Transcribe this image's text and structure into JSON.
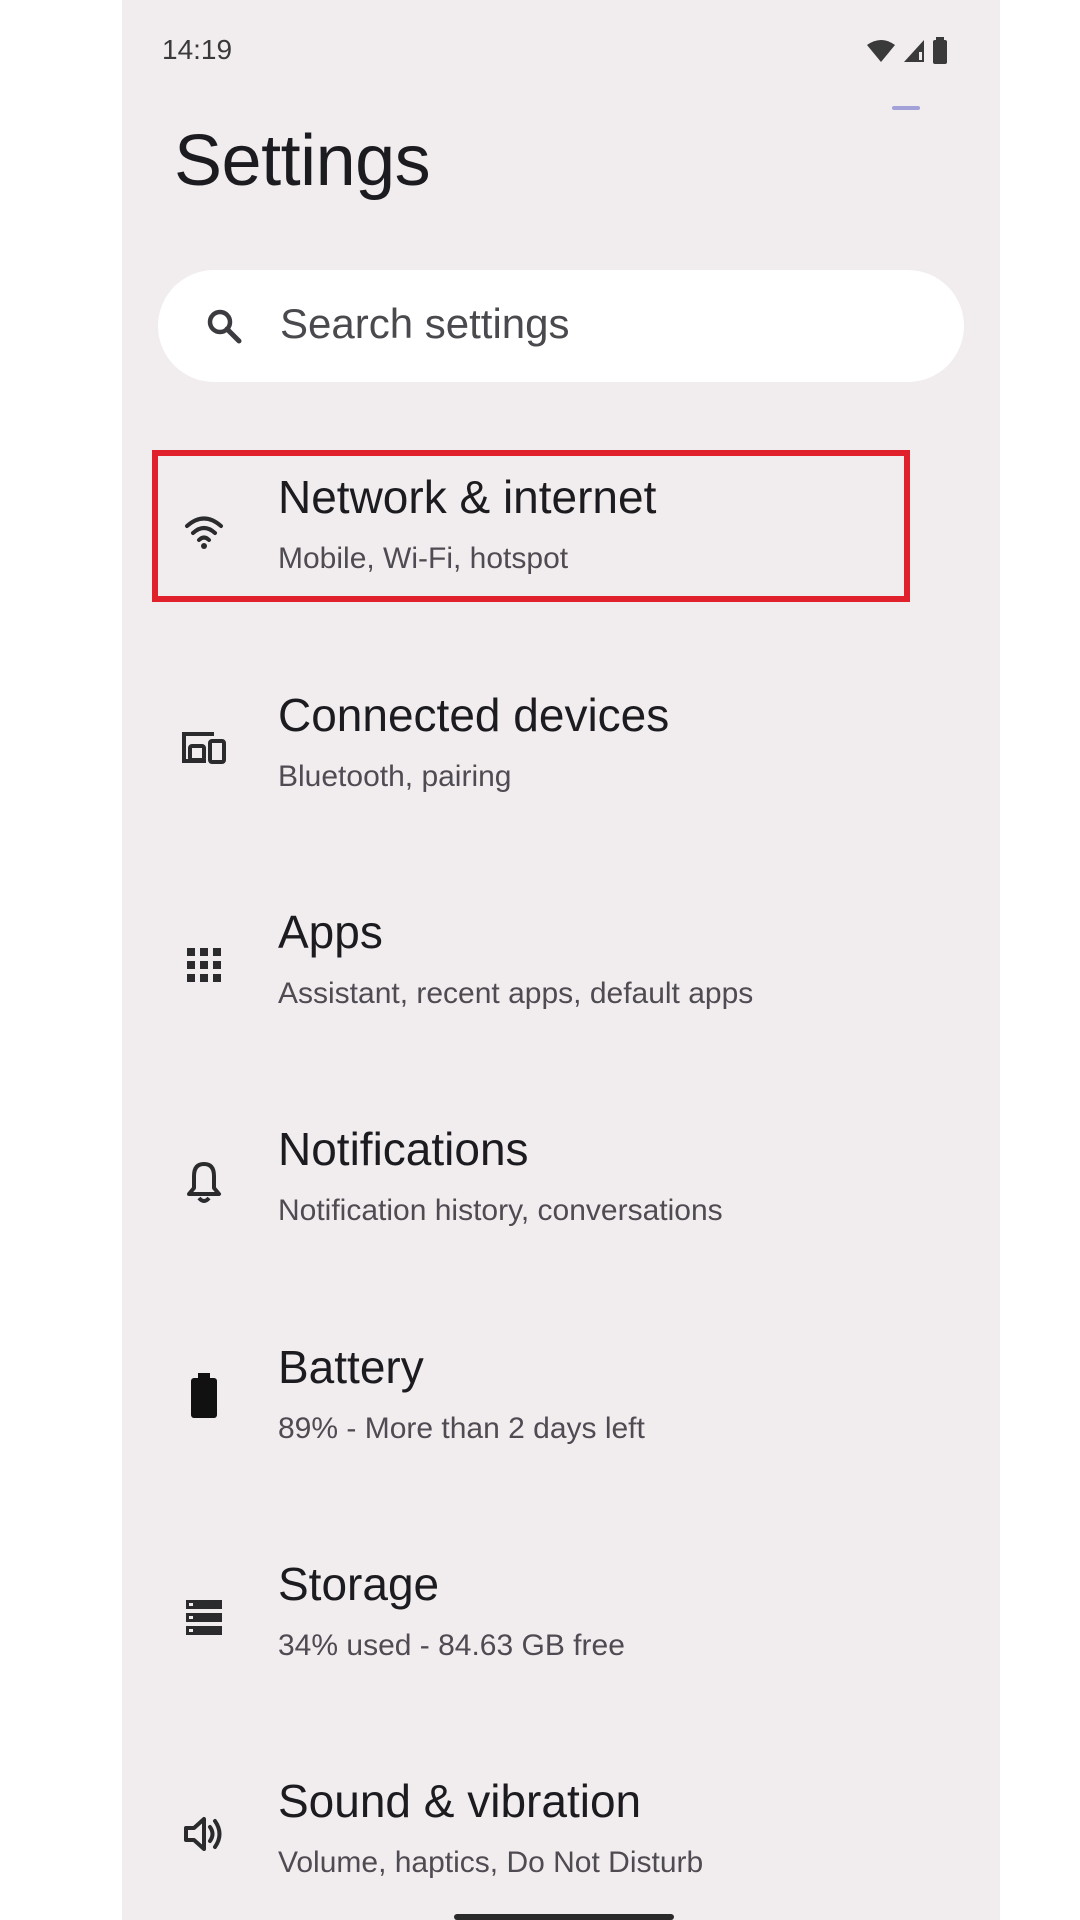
{
  "status_bar": {
    "time": "14:19",
    "icons": [
      "wifi-icon",
      "signal-icon",
      "battery-icon"
    ]
  },
  "header": {
    "title": "Settings"
  },
  "search": {
    "placeholder": "Search settings",
    "icon": "search-icon"
  },
  "settings": [
    {
      "id": "network",
      "title": "Network & internet",
      "subtitle": "Mobile, Wi-Fi, hotspot",
      "icon": "wifi-icon",
      "highlighted": true
    },
    {
      "id": "connected-devices",
      "title": "Connected devices",
      "subtitle": "Bluetooth, pairing",
      "icon": "devices-icon"
    },
    {
      "id": "apps",
      "title": "Apps",
      "subtitle": "Assistant, recent apps, default apps",
      "icon": "apps-grid-icon"
    },
    {
      "id": "notifications",
      "title": "Notifications",
      "subtitle": "Notification history, conversations",
      "icon": "bell-icon"
    },
    {
      "id": "battery",
      "title": "Battery",
      "subtitle": "89% - More than 2 days left",
      "icon": "battery-icon"
    },
    {
      "id": "storage",
      "title": "Storage",
      "subtitle": "34% used - 84.63 GB free",
      "icon": "storage-icon"
    },
    {
      "id": "sound",
      "title": "Sound & vibration",
      "subtitle": "Volume, haptics, Do Not Disturb",
      "icon": "volume-icon"
    }
  ],
  "colors": {
    "background": "#f1edef",
    "highlight_border": "#e0202a",
    "text_primary": "#1c1b1f",
    "text_secondary": "#4e4b52"
  }
}
